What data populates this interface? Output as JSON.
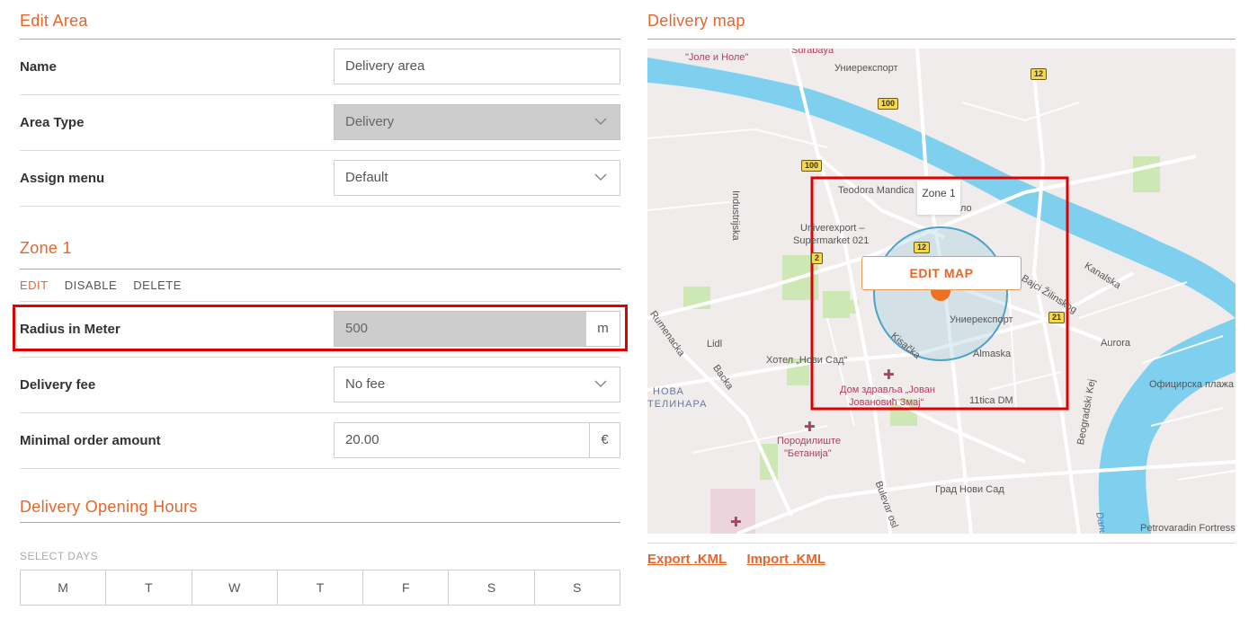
{
  "edit_area": {
    "title": "Edit Area",
    "name_label": "Name",
    "name_value": "Delivery area",
    "area_type_label": "Area Type",
    "area_type_value": "Delivery",
    "assign_menu_label": "Assign menu",
    "assign_menu_value": "Default"
  },
  "zone": {
    "title": "Zone 1",
    "actions": {
      "edit": "EDIT",
      "disable": "DISABLE",
      "delete": "DELETE"
    },
    "radius_label": "Radius in Meter",
    "radius_value": "500",
    "radius_unit": "m",
    "delivery_fee_label": "Delivery fee",
    "delivery_fee_value": "No fee",
    "min_order_label": "Minimal order amount",
    "min_order_value": "20.00",
    "min_order_unit": "€"
  },
  "opening_hours": {
    "title": "Delivery Opening Hours",
    "select_days_label": "SELECT DAYS",
    "days": [
      "M",
      "T",
      "W",
      "T",
      "F",
      "S",
      "S"
    ]
  },
  "delivery_map": {
    "title": "Delivery map",
    "zone_tooltip": "Zone 1",
    "edit_map_label": "EDIT MAP",
    "export_label": "Export .KML",
    "import_label": "Import .KML",
    "labels": {
      "surabaya": "Surabaya",
      "jole": "\"Јоле и Ноле\"",
      "univerexport_top": "Униерекспорт",
      "teodora": "Teodora Mandica",
      "industrijska": "Industrijska",
      "univerexport_market": "Univerexport –",
      "supermarket": "Supermarket 021",
      "univerexport_center": "Униерекспорт",
      "bajci": "Bajci Žilinskog",
      "kanalska": "Kanalska",
      "aurora": "Aurora",
      "rumenacka": "Rumenacka",
      "lidl": "Lidl",
      "backa": "Backa",
      "hotel": "Хотел „Нови Сад“",
      "kisacka": "Kisačka",
      "almaska": "Almaska",
      "nova": "НОВА",
      "telinara": "ТЕЛИНАРА",
      "dom1": "Дом здравља „Јован",
      "dom2": "Јовановић Змај“",
      "dm": "11tica DM",
      "oficirska": "Официрска плажа",
      "porodiliste1": "Породилиште",
      "porodiliste2": "\"Бетанија\"",
      "bulevar": "Bulevar osl",
      "beogradski": "Beogradski Kej",
      "grad": "Град Нови Сад",
      "danube": "Danube",
      "petrovaradin": "Petrovaradin Fortress",
      "zlo": "ло"
    },
    "badges": {
      "b12a": "12",
      "b100a": "100",
      "b100b": "100",
      "b12b": "12",
      "b2": "2",
      "b21": "21"
    },
    "colors": {
      "water": "#7ed0ee",
      "park": "#cde8b5",
      "zone_stroke": "#4aa3c8",
      "marker": "#f07020",
      "highlight": "#e00000"
    }
  }
}
